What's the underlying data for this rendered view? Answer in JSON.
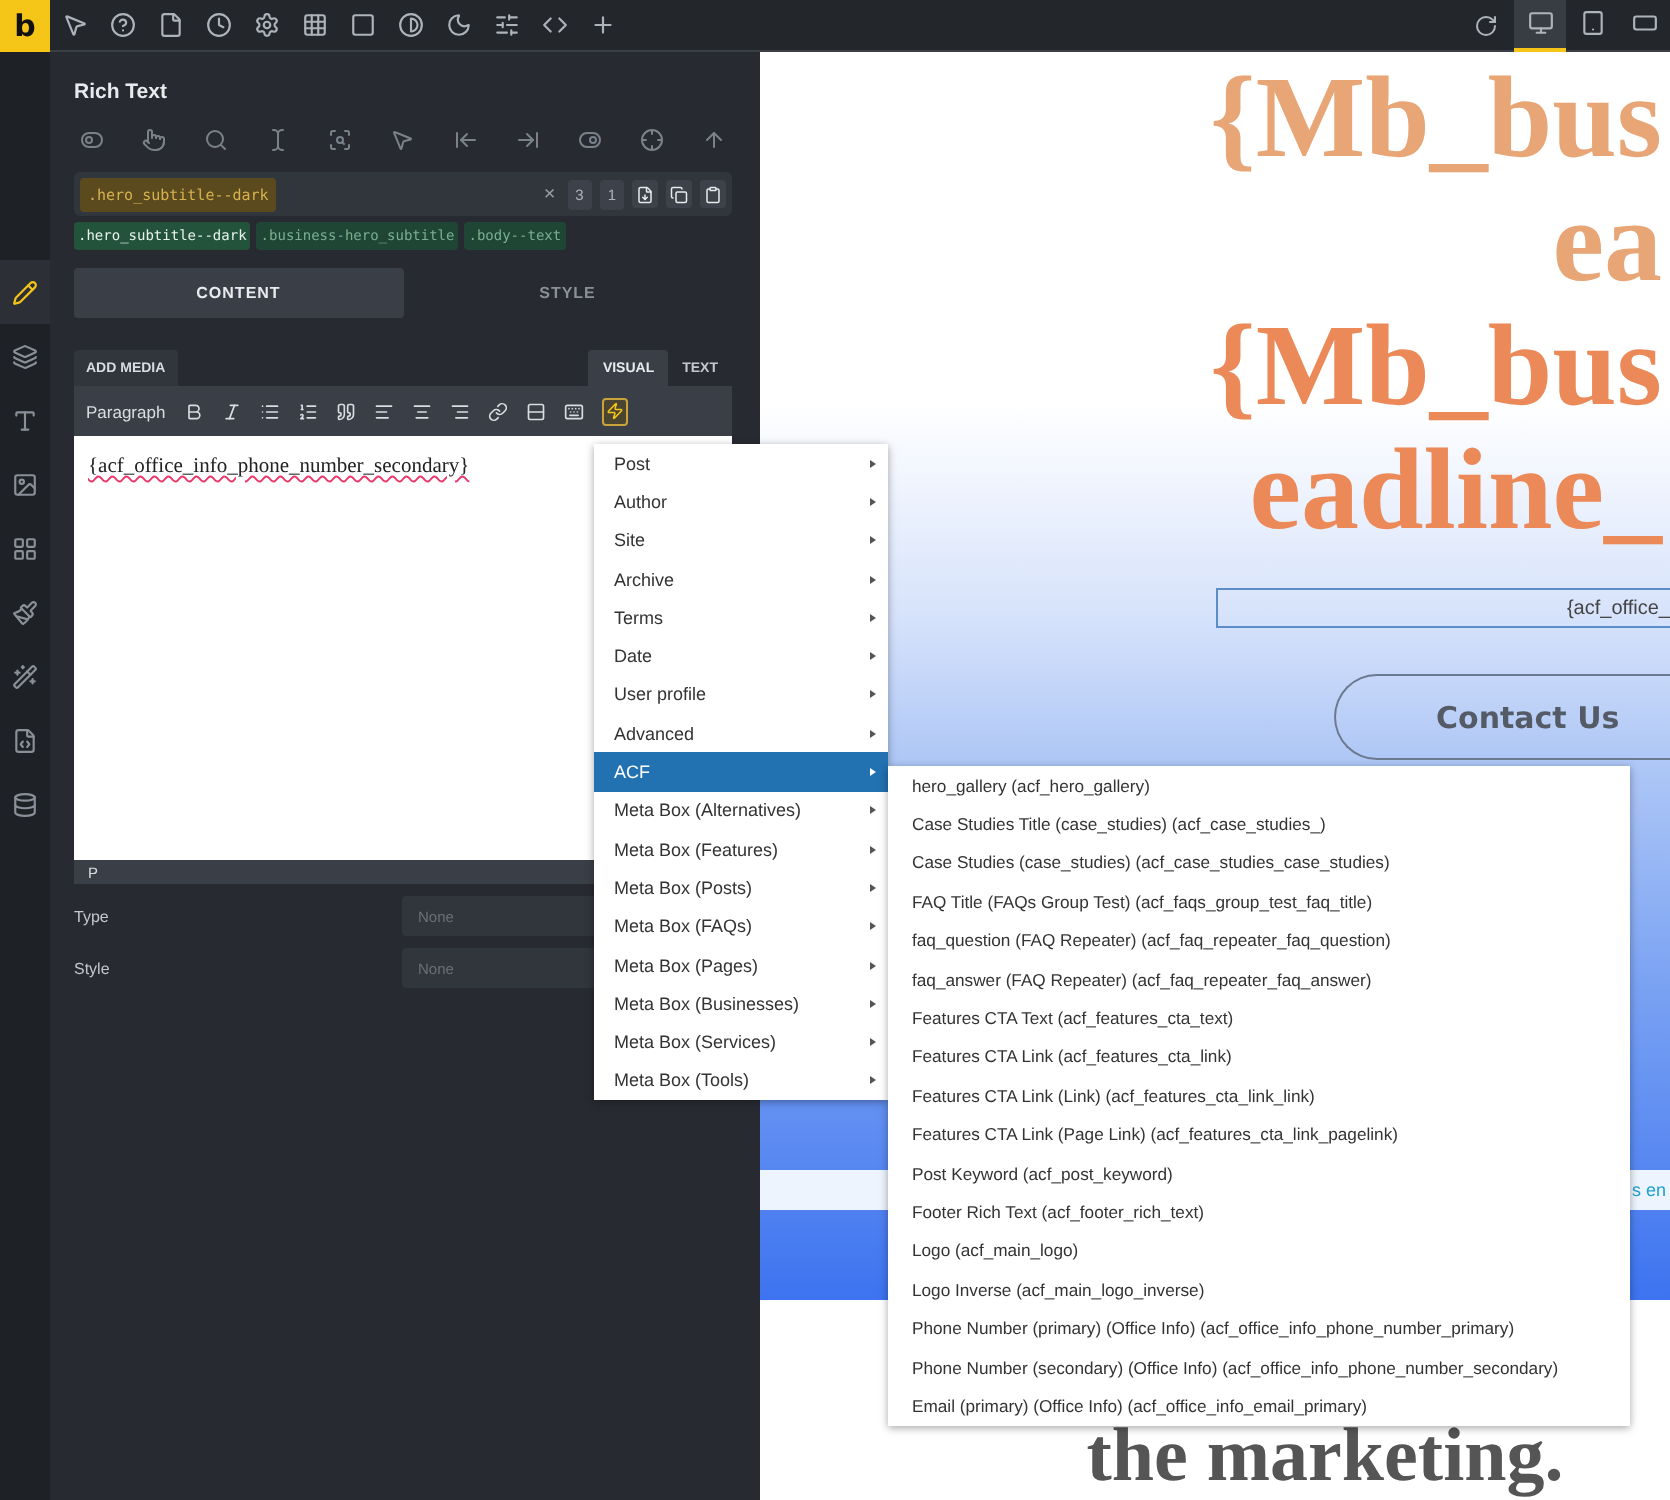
{
  "top_bar": {
    "logo": "b",
    "devices": [
      {
        "selected": true
      },
      {
        "selected": false
      },
      {
        "selected": false
      }
    ]
  },
  "rail": [
    {
      "selected": true
    },
    {
      "selected": false
    },
    {
      "selected": false
    },
    {
      "selected": false
    },
    {
      "selected": false
    },
    {
      "selected": false
    },
    {
      "selected": false
    },
    {
      "selected": false
    },
    {
      "selected": false
    }
  ],
  "panel": {
    "title": "Rich Text",
    "class_field": {
      "active_class": ".hero_subtitle--dark",
      "clear": "×",
      "counts": [
        "3",
        "1"
      ]
    },
    "class_chips": [
      {
        "label": ".hero_subtitle--dark",
        "selected": true
      },
      {
        "label": ".business-hero_subtitle",
        "selected": false
      },
      {
        "label": ".body--text",
        "selected": false
      }
    ],
    "tabs": [
      {
        "label": "CONTENT",
        "selected": true
      },
      {
        "label": "STYLE",
        "selected": false
      }
    ],
    "editor": {
      "add_media": "ADD MEDIA",
      "modes": [
        {
          "label": "VISUAL",
          "selected": true
        },
        {
          "label": "TEXT",
          "selected": false
        }
      ],
      "format": "Paragraph",
      "dynamic_data_active": true,
      "content": "{acf_office_info_phone_number_secondary}",
      "path": "P"
    },
    "fields": [
      {
        "label": "Type",
        "placeholder": "None"
      },
      {
        "label": "Style",
        "placeholder": "None"
      }
    ]
  },
  "dynamic_menu": {
    "items": [
      {
        "label": "Post",
        "selected": false
      },
      {
        "label": "Author",
        "selected": false
      },
      {
        "label": "Site",
        "selected": false
      },
      {
        "label": "Archive",
        "selected": false
      },
      {
        "label": "Terms",
        "selected": false
      },
      {
        "label": "Date",
        "selected": false
      },
      {
        "label": "User profile",
        "selected": false
      },
      {
        "label": "Advanced",
        "selected": false
      },
      {
        "label": "ACF",
        "selected": true
      },
      {
        "label": "Meta Box (Alternatives)",
        "selected": false
      },
      {
        "label": "Meta Box (Features)",
        "selected": false
      },
      {
        "label": "Meta Box (Posts)",
        "selected": false
      },
      {
        "label": "Meta Box (FAQs)",
        "selected": false
      },
      {
        "label": "Meta Box (Pages)",
        "selected": false
      },
      {
        "label": "Meta Box (Businesses)",
        "selected": false
      },
      {
        "label": "Meta Box (Services)",
        "selected": false
      },
      {
        "label": "Meta Box (Tools)",
        "selected": false
      }
    ]
  },
  "acf_submenu": {
    "items": [
      "hero_gallery (acf_hero_gallery)",
      "Case Studies Title (case_studies) (acf_case_studies_)",
      "Case Studies (case_studies) (acf_case_studies_case_studies)",
      "FAQ Title (FAQs Group Test) (acf_faqs_group_test_faq_title)",
      "faq_question (FAQ Repeater) (acf_faq_repeater_faq_question)",
      "faq_answer (FAQ Repeater) (acf_faq_repeater_faq_answer)",
      "Features CTA Text (acf_features_cta_text)",
      "Features CTA Link (acf_features_cta_link)",
      "Features CTA Link (Link) (acf_features_cta_link_link)",
      "Features CTA Link (Page Link) (acf_features_cta_link_pagelink)",
      "Post Keyword (acf_post_keyword)",
      "Footer Rich Text (acf_footer_rich_text)",
      "Logo (acf_main_logo)",
      "Logo Inverse (acf_main_logo_inverse)",
      "Phone Number (primary) (Office Info) (acf_office_info_phone_number_primary)",
      "Phone Number (secondary) (Office Info) (acf_office_info_phone_number_secondary)",
      "Email (primary) (Office Info) (acf_office_info_email_primary)"
    ]
  },
  "preview": {
    "heading_lines": [
      "{Mb_bus",
      "ea",
      "{Mb_bus",
      "eadline_"
    ],
    "field_text": "{acf_office_",
    "button": "Contact Us",
    "strip_text": "s en",
    "bottom_text": "the marketing."
  }
}
